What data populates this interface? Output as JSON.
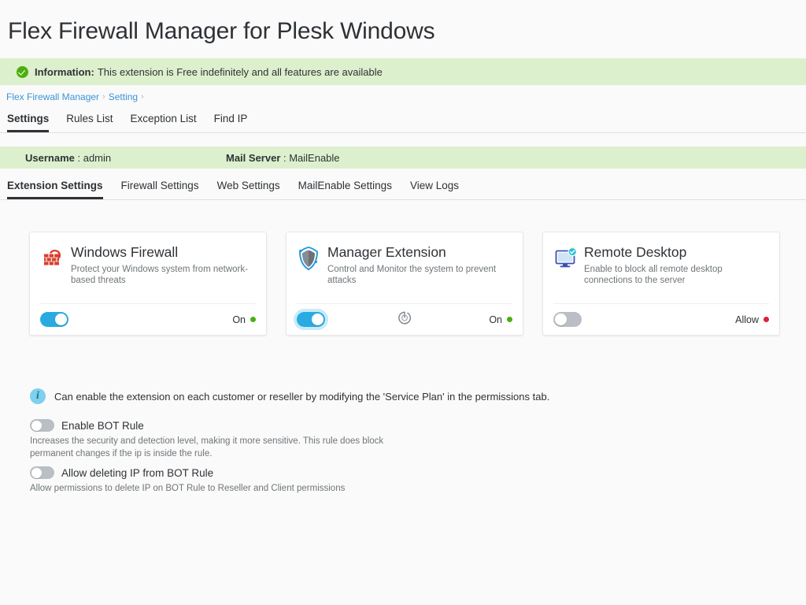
{
  "page": {
    "title": "Flex Firewall Manager for Plesk Windows"
  },
  "alert": {
    "icon": "check-circle-icon",
    "label": "Information:",
    "message": "This extension is Free indefinitely and all features are available",
    "bg_color": "#ddf0cd",
    "icon_color": "#4caf0f"
  },
  "breadcrumb": {
    "items": [
      "Flex Firewall Manager",
      "Setting"
    ],
    "separator": "›",
    "link_color": "#3b94d9"
  },
  "primary_tabs": {
    "active": "Settings",
    "items": [
      {
        "label": "Settings"
      },
      {
        "label": "Rules List"
      },
      {
        "label": "Exception List"
      },
      {
        "label": "Find IP"
      }
    ]
  },
  "user_strip": {
    "username_label": "Username",
    "username_value": "admin",
    "mailserver_label": "Mail Server",
    "mailserver_value": "MailEnable",
    "separator": " : "
  },
  "secondary_tabs": {
    "active": "Extension Settings",
    "items": [
      {
        "label": "Extension Settings"
      },
      {
        "label": "Firewall Settings"
      },
      {
        "label": "Web Settings"
      },
      {
        "label": "MailEnable Settings"
      },
      {
        "label": "View Logs"
      }
    ]
  },
  "cards": [
    {
      "icon": "brick-firewall-icon",
      "title": "Windows Firewall",
      "description": "Protect your Windows system from network-based threats",
      "toggle_state": "on",
      "toggle_focused": false,
      "status_label": "On",
      "status_color": "#4caf0f",
      "has_restart_button": false
    },
    {
      "icon": "shield-icon",
      "title": "Manager Extension",
      "description": "Control and Monitor the system to prevent attacks",
      "toggle_state": "on",
      "toggle_focused": true,
      "status_label": "On",
      "status_color": "#4caf0f",
      "has_restart_button": true,
      "restart_icon": "power-restart-icon"
    },
    {
      "icon": "remote-desktop-icon",
      "title": "Remote Desktop",
      "description": "Enable to block all remote desktop connections to the server",
      "toggle_state": "off",
      "toggle_focused": false,
      "status_label": "Allow",
      "status_color": "#e0203c",
      "has_restart_button": false
    }
  ],
  "note": {
    "icon": "info-circle-icon",
    "text": "Can enable the extension on each customer or reseller by modifying the 'Service Plan' in the permissions tab."
  },
  "rules": [
    {
      "label": "Enable BOT Rule",
      "description": "Increases the security and detection level, making it more sensitive. This rule does block permanent changes if the ip is inside the rule.",
      "toggle_state": "off"
    },
    {
      "label": "Allow deleting IP from BOT Rule",
      "description": "Allow permissions to delete IP on BOT Rule to Reseller and Client permissions",
      "toggle_state": "off"
    }
  ],
  "theme": {
    "accent": "#29abe2",
    "page_bg": "#fafafa",
    "card_bg": "#ffffff",
    "text": "#2e3236",
    "muted_text": "#6f7579"
  }
}
